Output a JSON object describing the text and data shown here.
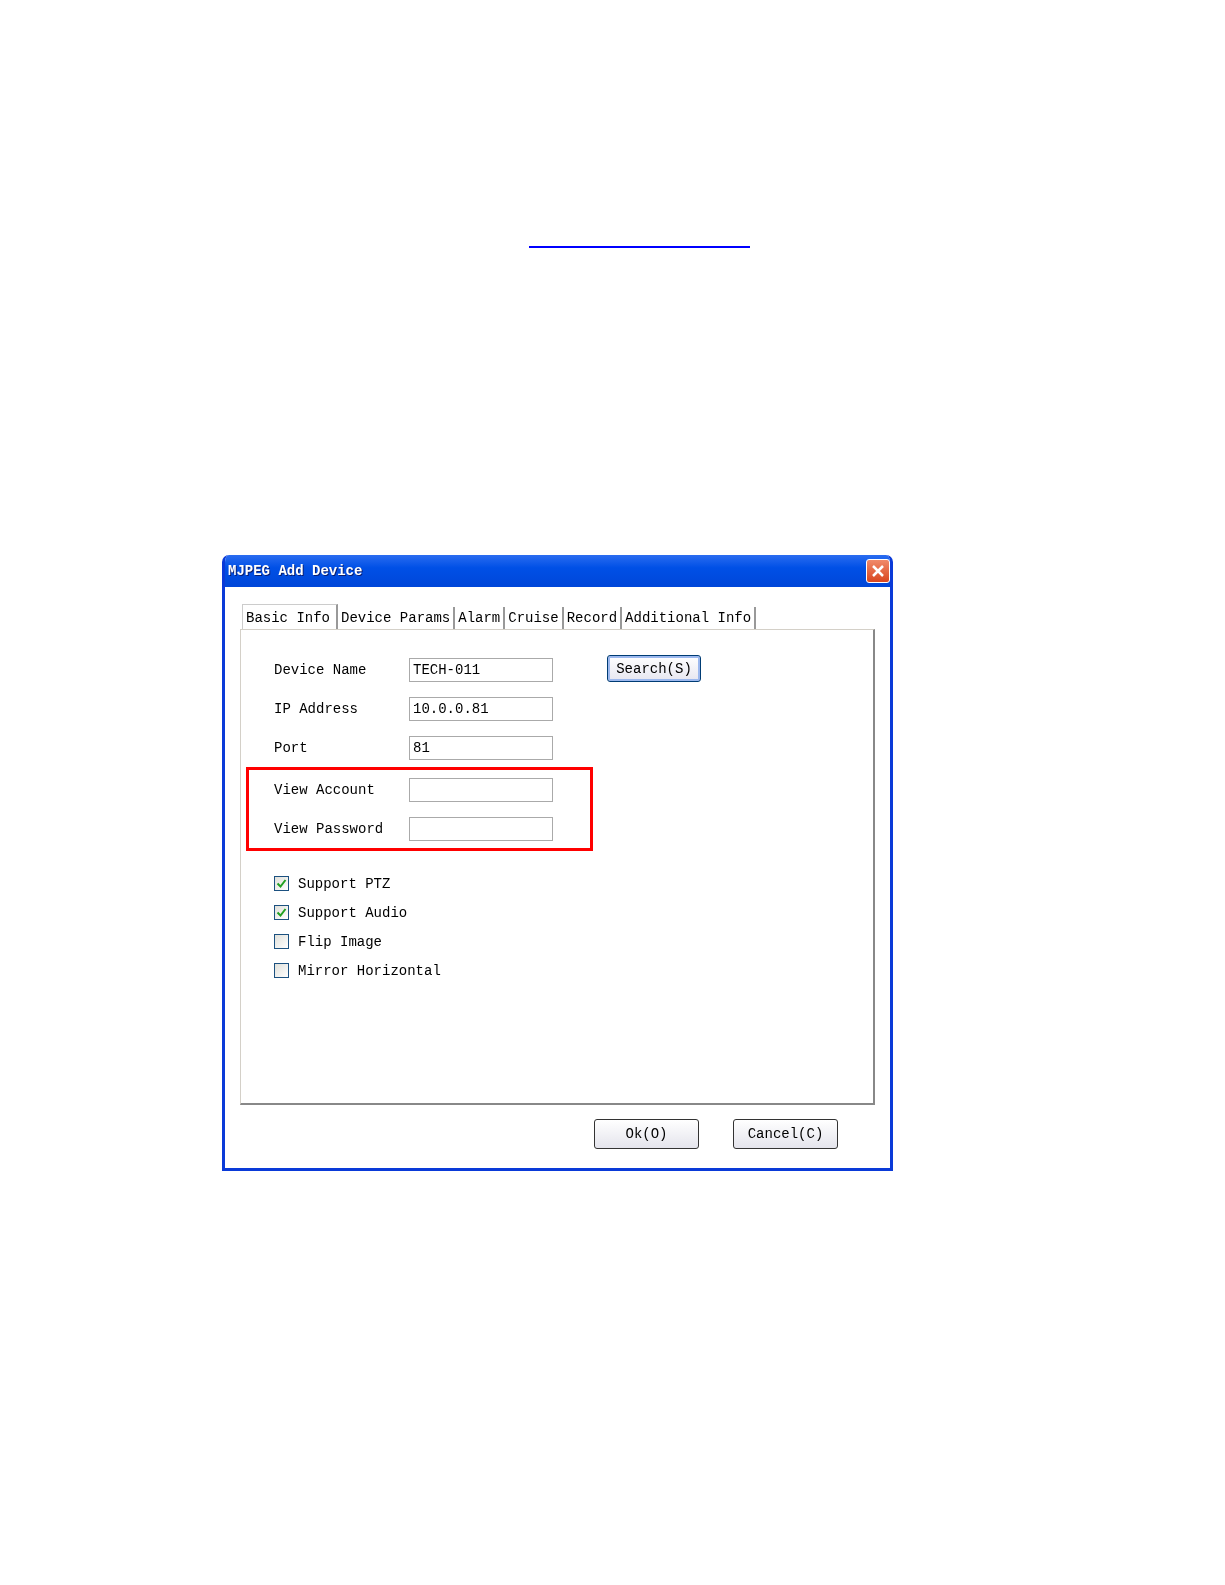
{
  "window": {
    "title": "MJPEG Add Device"
  },
  "tabs": [
    {
      "label": "Basic Info",
      "selected": true
    },
    {
      "label": "Device Params",
      "selected": false
    },
    {
      "label": "Alarm",
      "selected": false
    },
    {
      "label": "Cruise",
      "selected": false
    },
    {
      "label": "Record",
      "selected": false
    },
    {
      "label": "Additional Info",
      "selected": false
    }
  ],
  "fields": [
    {
      "label": "Device Name",
      "value": "TECH-011",
      "highlighted": false
    },
    {
      "label": "IP Address",
      "value": "10.0.0.81",
      "highlighted": false
    },
    {
      "label": "Port",
      "value": "81",
      "highlighted": false
    },
    {
      "label": "View Account",
      "highlighted": true
    },
    {
      "label": "View Password",
      "highlighted": true
    }
  ],
  "search_button": "Search(S)",
  "options": [
    {
      "label": "Support PTZ",
      "checked": true
    },
    {
      "label": "Support Audio",
      "checked": true
    },
    {
      "label": "Flip Image",
      "checked": false
    },
    {
      "label": "Mirror Horizontal",
      "checked": false
    }
  ],
  "buttons": [
    "Ok(O)",
    "Cancel(C)"
  ]
}
